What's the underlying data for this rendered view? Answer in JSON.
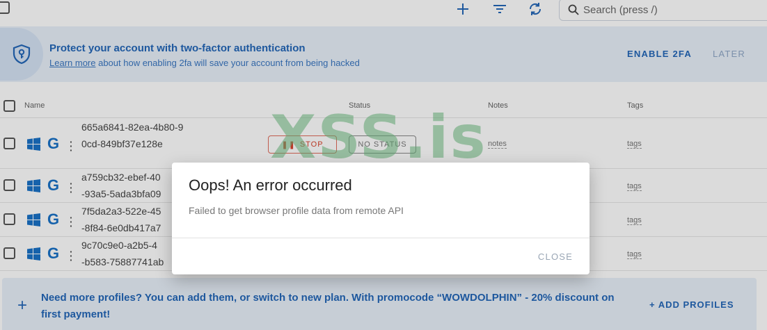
{
  "toolbar": {
    "search_placeholder": "Search (press /)",
    "icons": [
      "plus-icon",
      "filter-icon",
      "refresh-icon",
      "search-icon"
    ]
  },
  "banner": {
    "title": "Protect your account with two-factor authentication",
    "learn_more": "Learn more",
    "subtitle_rest": " about how enabling 2fa will save your account from being hacked",
    "enable_label": "ENABLE 2FA",
    "later_label": "LATER"
  },
  "table": {
    "headers": {
      "name": "Name",
      "status": "Status",
      "notes": "Notes",
      "tags": "Tags"
    },
    "rows": [
      {
        "uuid": "665a6841-82ea-4b80-90cd-849bf37e128e",
        "stop_label": "STOP",
        "status_label": "NO STATUS",
        "notes": "notes",
        "tags": "tags"
      },
      {
        "uuid": "a759cb32-ebef-40",
        "uuid_line2": "-93a5-5ada3bfa09",
        "tags": "tags"
      },
      {
        "uuid": "7f5da2a3-522e-45",
        "uuid_line2": "-8f84-6e0db417a7",
        "tags": "tags"
      },
      {
        "uuid": "9c70c9e0-a2b5-4",
        "uuid_line2": "-b583-75887741ab",
        "tags": "tags"
      }
    ]
  },
  "promo": {
    "text": "Need more profiles? You can add them, or switch to new plan. With promocode “WOWDOLPHIN” - 20% discount on first payment!",
    "button": "+ ADD PROFILES"
  },
  "watermark": "XSS.is",
  "dialog": {
    "title": "Oops! An error occurred",
    "message": "Failed to get browser profile data from remote API",
    "close_label": "CLOSE"
  },
  "colors": {
    "accent": "#2367b8",
    "banner_bg": "#e8f0fa",
    "stop_red": "#d9442e",
    "watermark_green": "#6ebe82"
  }
}
